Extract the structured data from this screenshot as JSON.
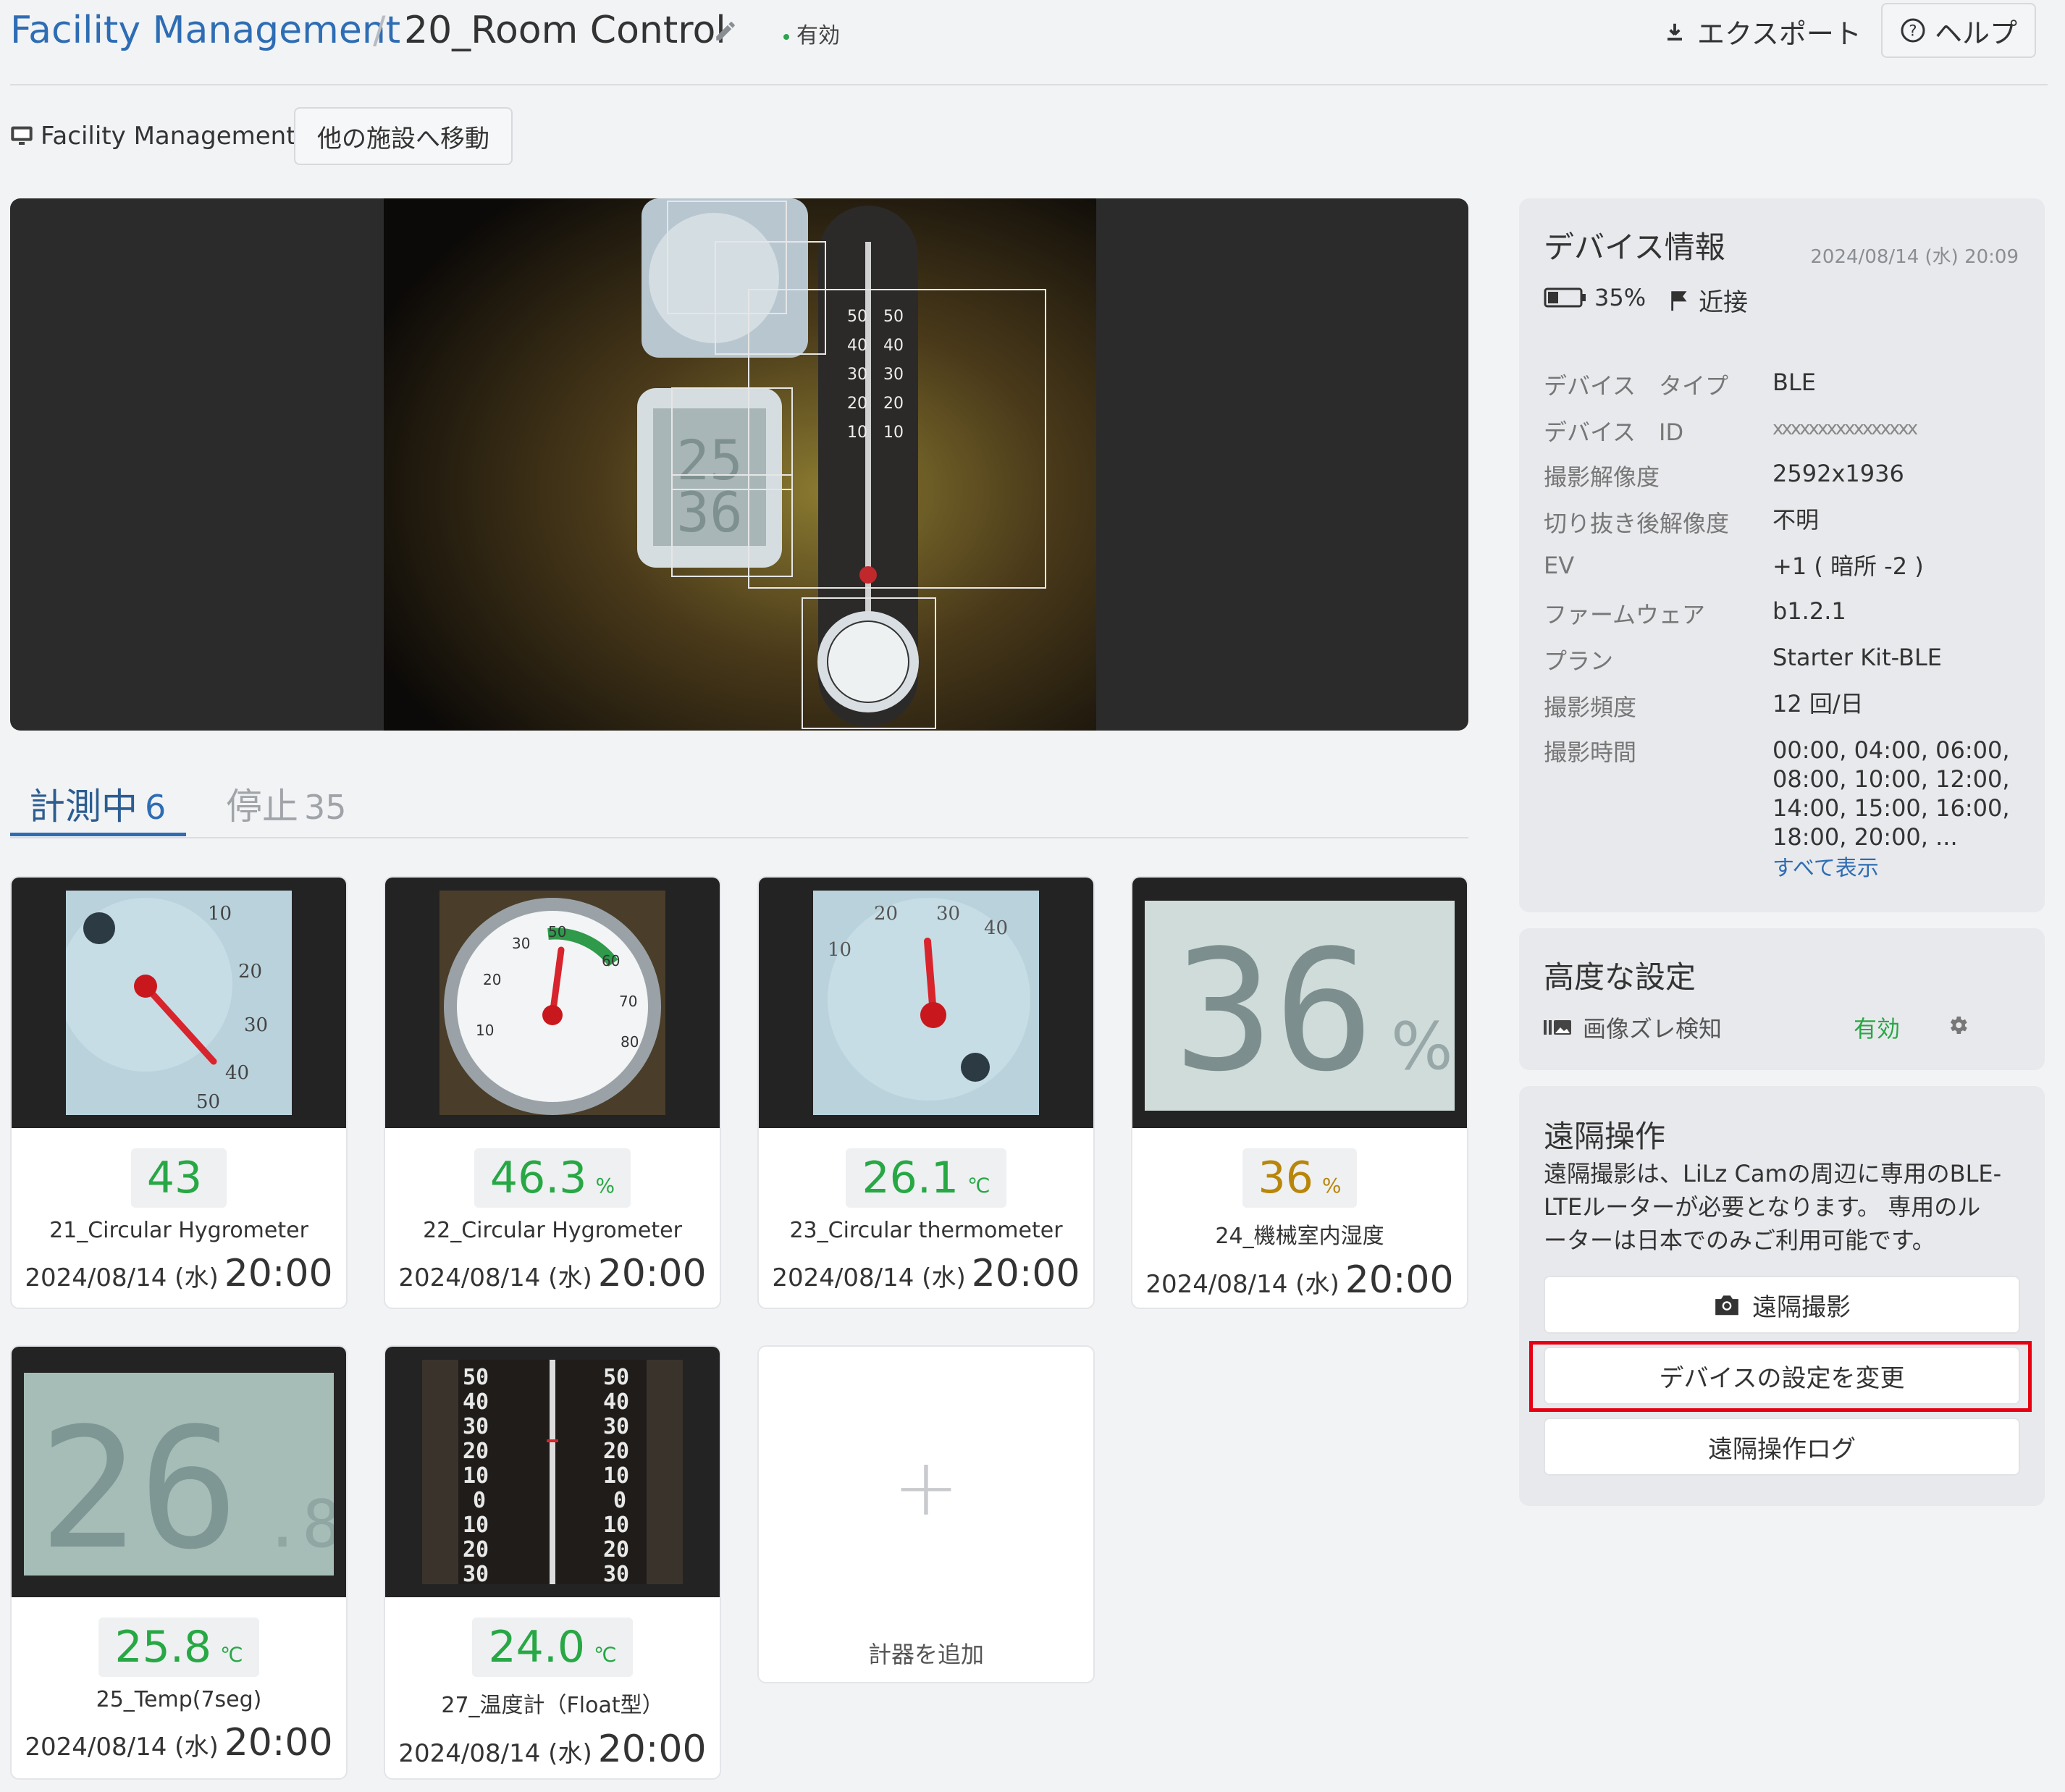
{
  "header": {
    "breadcrumb_root": "Facility Management",
    "breadcrumb_sep": "/",
    "title": "20_Room Control",
    "status": "有効",
    "export_label": "エクスポート",
    "help_label": "ヘルプ"
  },
  "facility": {
    "name": "Facility Management",
    "move_button": "他の施設へ移動"
  },
  "tabs": [
    {
      "label": "計測中",
      "count": "6"
    },
    {
      "label": "停止",
      "count": "35"
    }
  ],
  "cards": [
    {
      "value": "43",
      "unit": "",
      "name": "21_Circular Hygrometer",
      "date": "2024/08/14 (水)",
      "time": "20:00",
      "icon": "circular-hygrometer-icon"
    },
    {
      "value": "46.3",
      "unit": "%",
      "name": "22_Circular Hygrometer",
      "date": "2024/08/14 (水)",
      "time": "20:00",
      "icon": "circular-hygrometer-icon"
    },
    {
      "value": "26.1",
      "unit": "℃",
      "name": "23_Circular thermometer",
      "date": "2024/08/14 (水)",
      "time": "20:00",
      "icon": "circular-thermometer-icon"
    },
    {
      "value": "36",
      "unit": "%",
      "name": "24_機械室内湿度",
      "date": "2024/08/14 (水)",
      "time": "20:00",
      "icon": "seven-segment-display-icon"
    },
    {
      "value": "25.8",
      "unit": "℃",
      "name": "25_Temp(7seg)",
      "date": "2024/08/14 (水)",
      "time": "20:00",
      "icon": "seven-segment-display-icon"
    },
    {
      "value": "24.0",
      "unit": "℃",
      "name": "27_温度計（Float型）",
      "date": "2024/08/14 (水)",
      "time": "20:00",
      "icon": "float-thermometer-icon"
    }
  ],
  "add_card": {
    "plus": "+",
    "label": "計器を追加"
  },
  "device_info": {
    "title": "デバイス情報",
    "date": "2024/08/14 (水) 20:09",
    "battery": "35%",
    "signal": "近接",
    "rows": [
      {
        "key": "デバイス　タイプ",
        "value": "BLE"
      },
      {
        "key": "デバイス　ID",
        "value": "xxxxxxxxxxxxxxxx"
      },
      {
        "key": "撮影解像度",
        "value": "2592x1936"
      },
      {
        "key": "切り抜き後解像度",
        "value": "不明"
      },
      {
        "key": "EV",
        "value": "+1 ( 暗所 -2 )"
      },
      {
        "key": "ファームウェア",
        "value": "b1.2.1"
      },
      {
        "key": "プラン",
        "value": "Starter Kit-BLE"
      },
      {
        "key": "撮影頻度",
        "value": "12 回/日"
      },
      {
        "key": "撮影時間",
        "value": "00:00, 04:00, 06:00,"
      }
    ],
    "times_lines": [
      "08:00, 10:00, 12:00,",
      "14:00, 15:00, 16:00,",
      "18:00, 20:00, ..."
    ],
    "show_all": "すべて表示"
  },
  "advanced": {
    "title": "高度な設定",
    "item_label": "画像ズレ検知",
    "item_status": "有効"
  },
  "remote": {
    "title": "遠隔操作",
    "desc_lines": [
      "遠隔撮影は、LiLz Camの周辺に専用のBLE-",
      "LTEルーターが必要となります。 専用のル",
      "ーターは日本でのみご利用可能です。"
    ],
    "capture_button": "遠隔撮影",
    "settings_button": "デバイスの設定を変更",
    "log_button": "遠隔操作ログ"
  },
  "colors": {
    "accent": "#2e6db4",
    "value_green": "#28a745",
    "value_amber": "#b8860b",
    "highlight": "#e60012"
  }
}
